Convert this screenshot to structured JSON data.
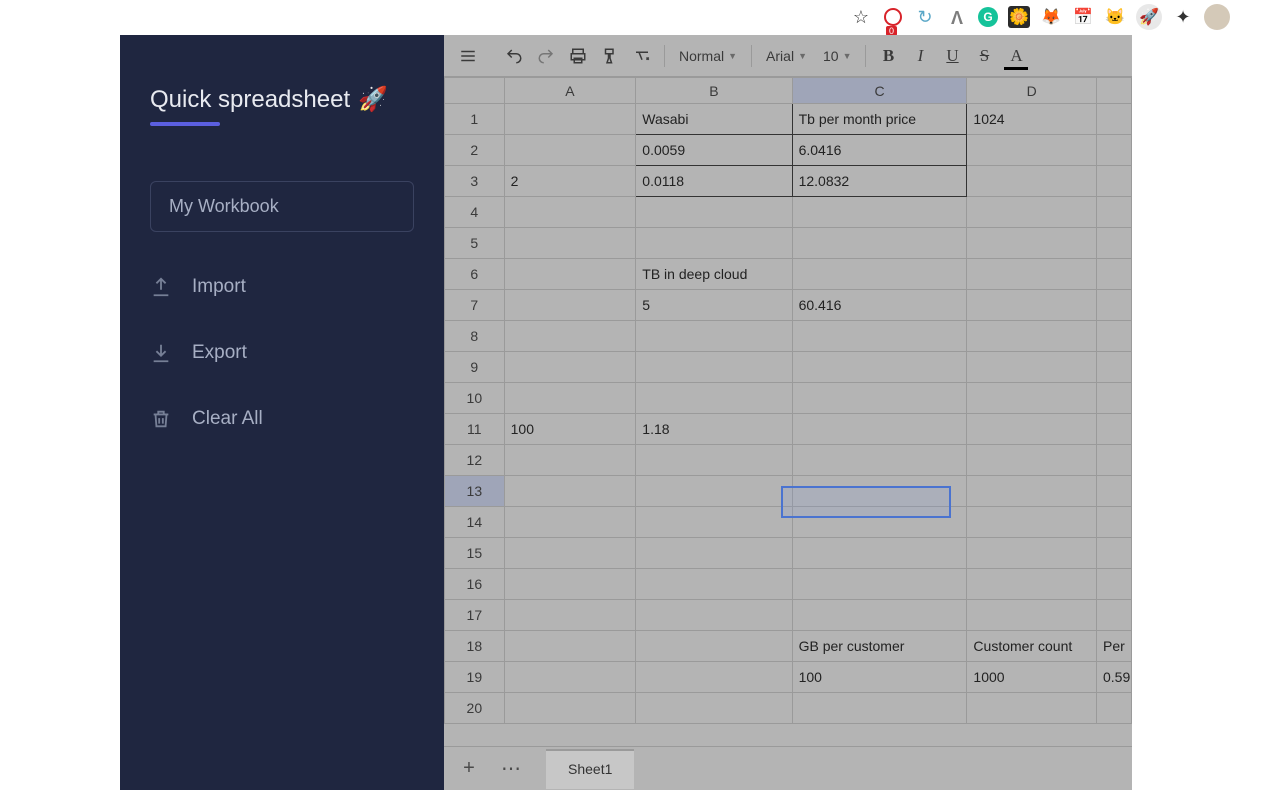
{
  "browser": {
    "star": "☆",
    "badge_count": "0",
    "ext_icons": [
      "ublock",
      "recycle",
      "vue",
      "grammarly",
      "box_orange",
      "fox",
      "cal",
      "panda",
      "rocket",
      "puzzle"
    ]
  },
  "sidebar": {
    "title": "Quick spreadsheet",
    "emoji": "🚀",
    "workbook_name": "My Workbook",
    "items": [
      {
        "icon": "upload",
        "label": "Import"
      },
      {
        "icon": "download",
        "label": "Export"
      },
      {
        "icon": "trash",
        "label": "Clear All"
      }
    ]
  },
  "toolbar": {
    "format_dropdown": "Normal",
    "font_dropdown": "Arial",
    "size_dropdown": "10",
    "bold": "B",
    "italic": "I",
    "underline": "U",
    "strike": "S",
    "fontcolor": "A"
  },
  "grid": {
    "cols": [
      "A",
      "B",
      "C",
      "D",
      ""
    ],
    "rows_count": 20,
    "active_cell": {
      "col": "C",
      "row": 13
    },
    "data": {
      "1": {
        "B": "Wasabi",
        "C": "Tb per month price",
        "D": "1024"
      },
      "2": {
        "B": "0.0059",
        "C": "6.0416"
      },
      "3": {
        "A": "2",
        "B": "0.0118",
        "C": "12.0832"
      },
      "6": {
        "B": "TB in deep cloud"
      },
      "7": {
        "B": "5",
        "C": "60.416"
      },
      "11": {
        "A": "100",
        "B": "1.18"
      },
      "18": {
        "C": "GB per customer",
        "D": "Customer count",
        "E": "Per"
      },
      "19": {
        "C": "100",
        "D": "1000",
        "E": "0.59"
      }
    },
    "bordered_range": {
      "rows": [
        1,
        2,
        3
      ],
      "cols": [
        "B",
        "C"
      ]
    }
  },
  "sheet_tabs": {
    "current": "Sheet1"
  }
}
